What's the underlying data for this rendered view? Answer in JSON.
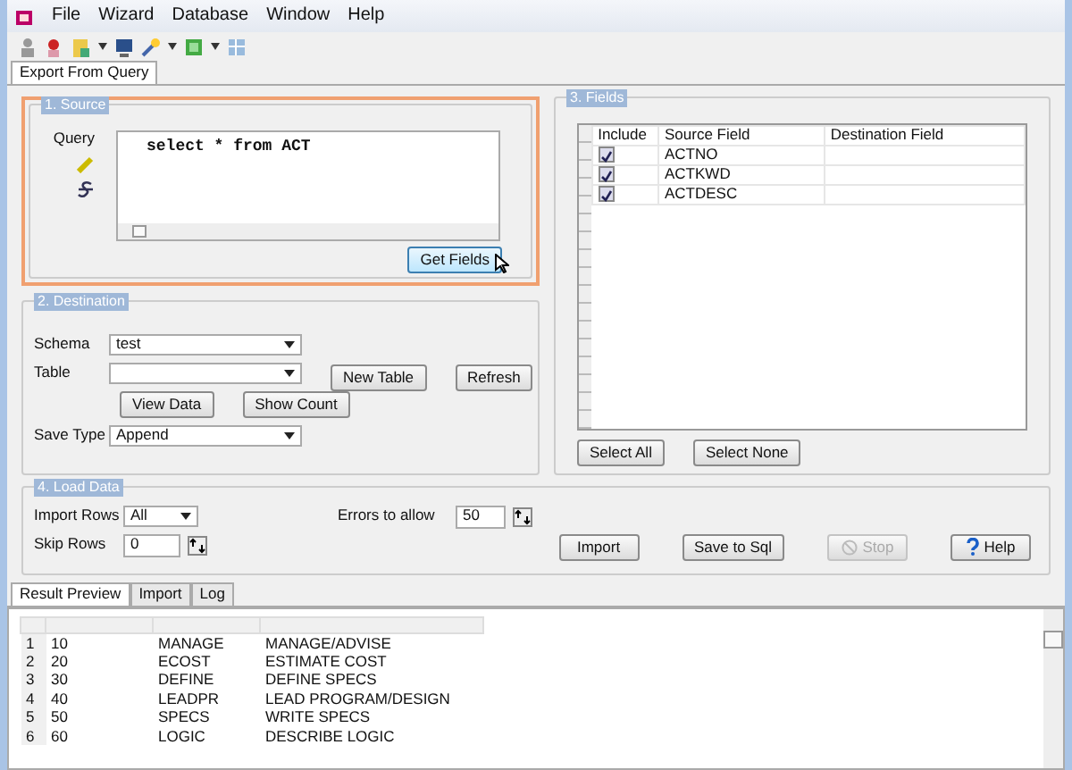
{
  "menu": [
    "File",
    "Wizard",
    "Database",
    "Window",
    "Help"
  ],
  "doc_tabs": [
    {
      "label": "Export From Query",
      "selected": true
    }
  ],
  "source": {
    "title": "1. Source",
    "query_label": "Query",
    "query": "select * from ACT",
    "button": "Get Fields"
  },
  "destination": {
    "title": "2. Destination",
    "schema_label": "Schema",
    "schema": "test",
    "table_label": "Table",
    "new_table": "New Table",
    "refresh": "Refresh",
    "view_data": "View Data",
    "show_count": "Show Count",
    "save_type_label": "Save Type",
    "save_type": "Append"
  },
  "fields": {
    "title": "3. Fields",
    "columns": [
      "Include",
      "Source Field",
      "Destination Field"
    ],
    "rows": [
      {
        "checked": true,
        "source": "ACTNO"
      },
      {
        "checked": true,
        "source": "ACTKWD"
      },
      {
        "checked": true,
        "source": "ACTDESC"
      }
    ],
    "select_all": "Select All",
    "select_none": "Select None"
  },
  "load": {
    "title": "4. Load Data",
    "import_rows_label": "Import Rows",
    "import_rows": "All",
    "skip_rows_label": "Skip Rows",
    "skip_rows": "0",
    "errors_label": "Errors to allow",
    "errors": "50",
    "buttons": [
      {
        "label": "Import",
        "disabled": false,
        "kind": "plain"
      },
      {
        "label": "Save to Sql",
        "disabled": false,
        "kind": "plain"
      },
      {
        "label": "Stop",
        "disabled": true,
        "kind": "stop"
      },
      {
        "label": "Help",
        "disabled": false,
        "kind": "help"
      }
    ]
  },
  "result_tabs": [
    {
      "label": "Result Preview",
      "selected": true
    },
    {
      "label": "Import",
      "selected": false
    },
    {
      "label": "Log",
      "selected": false
    }
  ],
  "results": [
    [
      "1",
      "10",
      "MANAGE",
      "MANAGE/ADVISE"
    ],
    [
      "2",
      "20",
      "ECOST",
      "ESTIMATE COST"
    ],
    [
      "3",
      "30",
      "DEFINE",
      "DEFINE SPECS"
    ],
    [
      "4",
      "40",
      "LEADPR",
      "LEAD PROGRAM/DESIGN"
    ],
    [
      "5",
      "50",
      "SPECS",
      "WRITE SPECS"
    ],
    [
      "6",
      "60",
      "LOGIC",
      "DESCRIBE LOGIC"
    ]
  ]
}
